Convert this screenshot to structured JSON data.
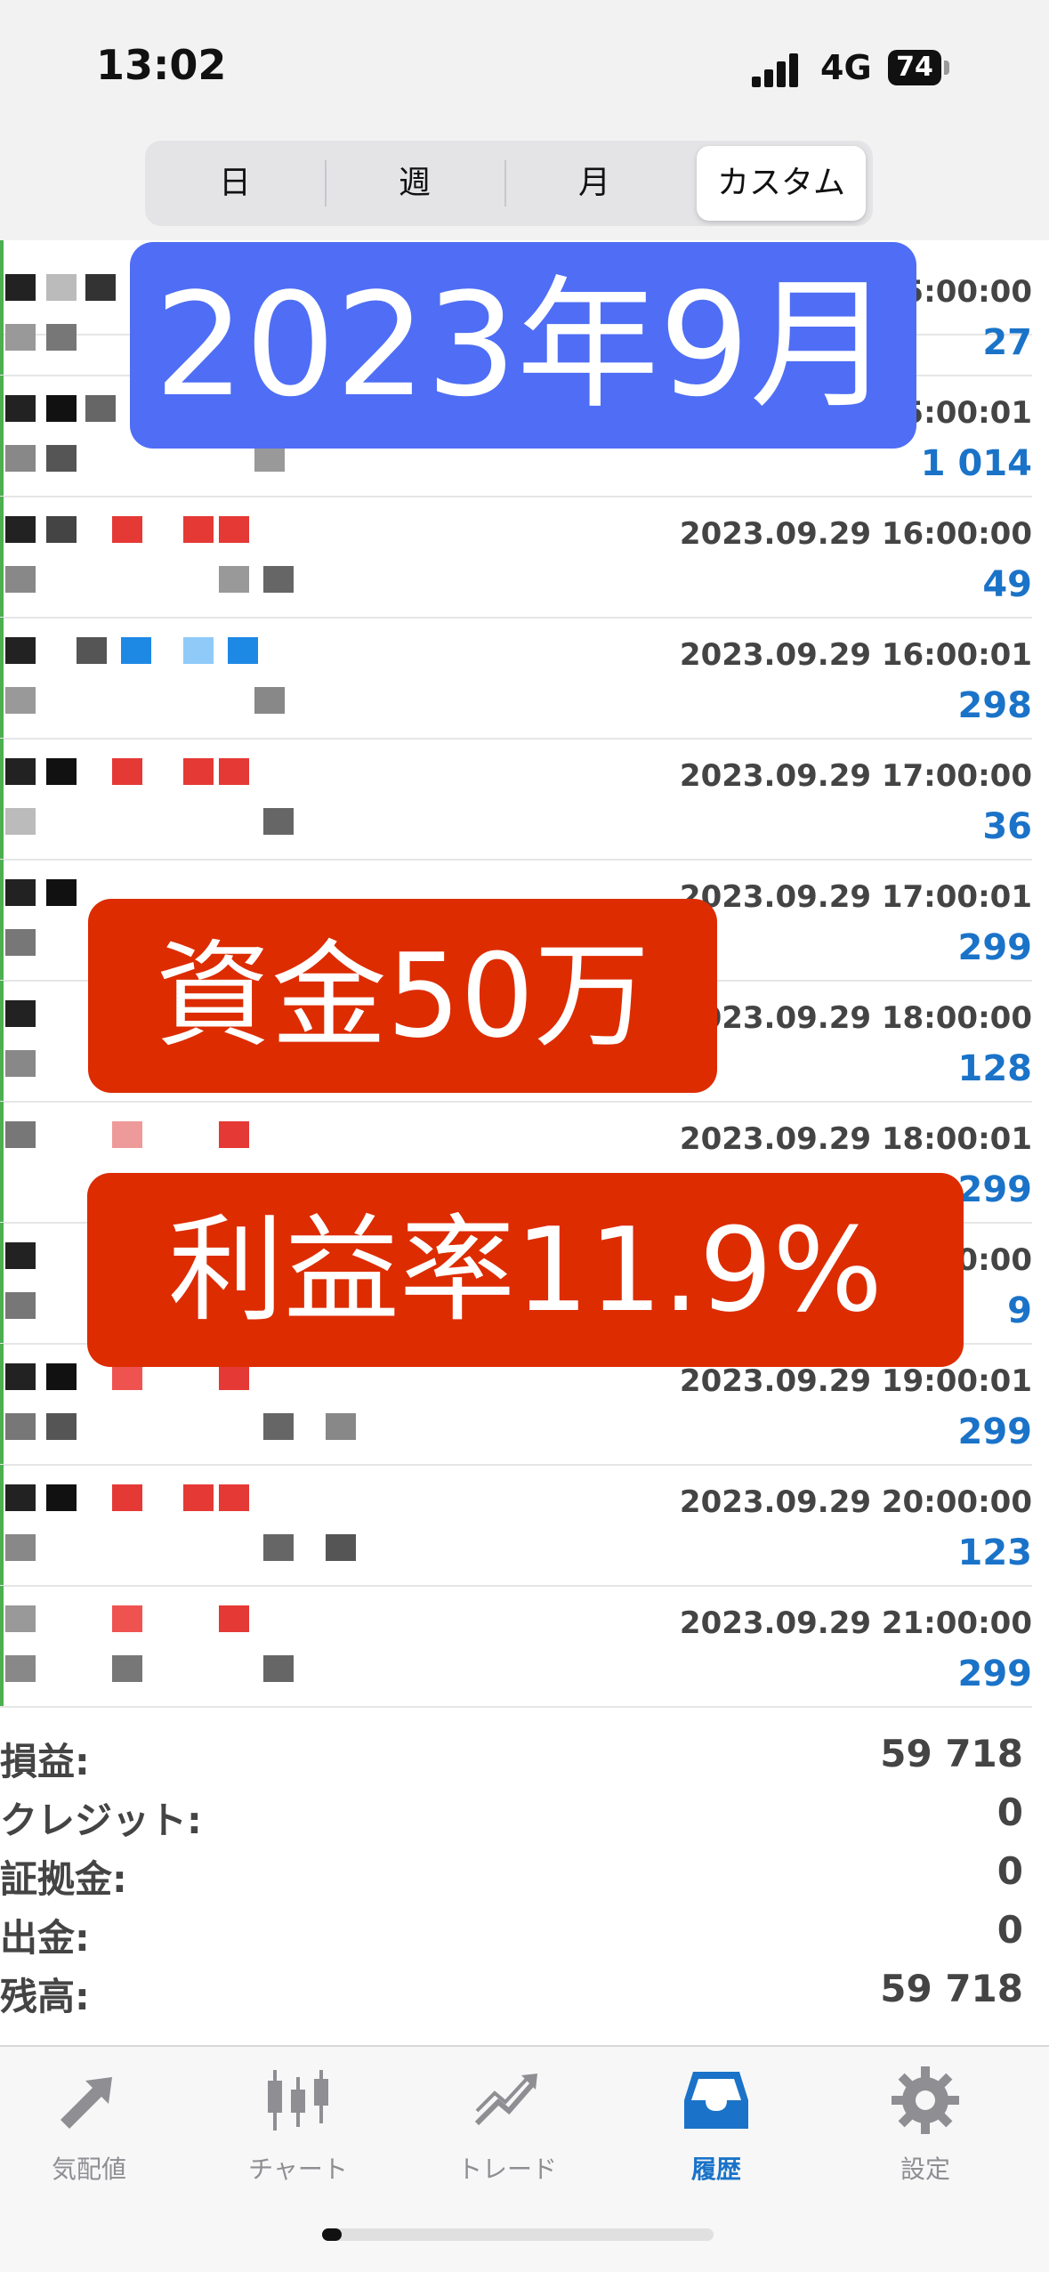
{
  "status_bar": {
    "time": "13:02",
    "network": "4G",
    "battery": "74"
  },
  "period_tabs": [
    {
      "label": "日",
      "active": false
    },
    {
      "label": "週",
      "active": false
    },
    {
      "label": "月",
      "active": false
    },
    {
      "label": "カスタム",
      "active": true
    }
  ],
  "trades": [
    {
      "time": "5:00:00",
      "value": "27"
    },
    {
      "time": "5:00:01",
      "value": "1 014"
    },
    {
      "time": "2023.09.29 16:00:00",
      "value": "49"
    },
    {
      "time": "2023.09.29 16:00:01",
      "value": "298"
    },
    {
      "time": "2023.09.29 17:00:00",
      "value": "36"
    },
    {
      "time": "2023.09.29 17:00:01",
      "value": "299"
    },
    {
      "time": "2023.09.29 18:00:00",
      "value": "128"
    },
    {
      "time": "2023.09.29 18:00:01",
      "value": "299"
    },
    {
      "time": "0:00",
      "value": "9"
    },
    {
      "time": "2023.09.29 19:00:01",
      "value": "299"
    },
    {
      "time": "2023.09.29 20:00:00",
      "value": "123"
    },
    {
      "time": "2023.09.29 21:00:00",
      "value": "299"
    }
  ],
  "overlays": {
    "month": "2023年9月",
    "fund": "資金50万",
    "profit_rate": "利益率11.9%"
  },
  "summary": [
    {
      "label": "損益:",
      "value": "59 718"
    },
    {
      "label": "クレジット:",
      "value": "0"
    },
    {
      "label": "証拠金:",
      "value": "0"
    },
    {
      "label": "出金:",
      "value": "0"
    },
    {
      "label": "残高:",
      "value": "59 718"
    }
  ],
  "tabbar": [
    {
      "label": "気配値",
      "icon": "quotes-arrows-icon",
      "active": false
    },
    {
      "label": "チャート",
      "icon": "candlestick-chart-icon",
      "active": false
    },
    {
      "label": "トレード",
      "icon": "trade-trend-icon",
      "active": false
    },
    {
      "label": "履歴",
      "icon": "history-inbox-icon",
      "active": true
    },
    {
      "label": "設定",
      "icon": "settings-gear-icon",
      "active": false
    }
  ],
  "colors": {
    "accent_blue": "#1a73c8",
    "month_badge": "#4f6ef5",
    "red_badge": "#dd2c00",
    "profit_value": "#1a73c8"
  }
}
